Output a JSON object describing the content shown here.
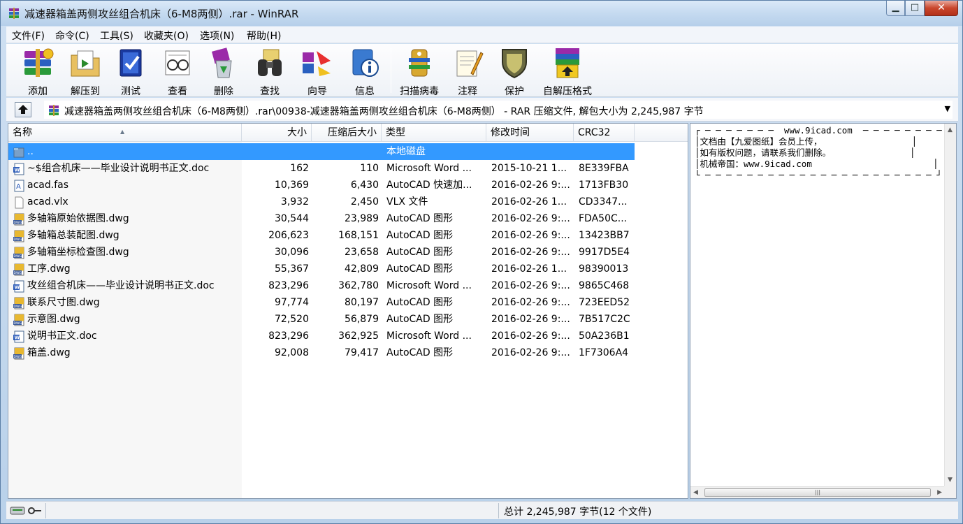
{
  "window": {
    "title": "减速器箱盖两侧攻丝组合机床（6-M8两侧）.rar - WinRAR",
    "minimize_glyph": "▁",
    "maximize_glyph": "□",
    "close_glyph": "✕"
  },
  "menu": {
    "items": [
      "文件(F)",
      "命令(C)",
      "工具(S)",
      "收藏夹(O)",
      "选项(N)",
      "帮助(H)"
    ]
  },
  "toolbar": {
    "buttons": [
      {
        "label": "添加",
        "icon": "books-stack-icon"
      },
      {
        "label": "解压到",
        "icon": "extract-folder-icon"
      },
      {
        "label": "测试",
        "icon": "test-book-icon"
      },
      {
        "label": "查看",
        "icon": "view-glasses-icon"
      },
      {
        "label": "删除",
        "icon": "delete-recycle-icon"
      },
      {
        "label": "查找",
        "icon": "binoculars-icon"
      },
      {
        "label": "向导",
        "icon": "wizard-icon"
      },
      {
        "label": "信息",
        "icon": "info-icon"
      },
      {
        "label": "扫描病毒",
        "icon": "virus-scan-icon"
      },
      {
        "label": "注释",
        "icon": "comment-note-icon"
      },
      {
        "label": "保护",
        "icon": "shield-protect-icon"
      },
      {
        "label": "自解压格式",
        "icon": "sfx-box-icon"
      }
    ]
  },
  "address": {
    "path": "减速器箱盖两侧攻丝组合机床（6-M8两侧）.rar\\00938-减速器箱盖两侧攻丝组合机床（6-M8两侧） - RAR 压缩文件, 解包大小为 2,245,987 字节",
    "dropdown_glyph": "▼"
  },
  "columns": {
    "name": "名称",
    "size": "大小",
    "packed": "压缩后大小",
    "type": "类型",
    "mtime": "修改时间",
    "crc": "CRC32"
  },
  "files": [
    {
      "name": "..",
      "size": "",
      "packed": "",
      "type": "本地磁盘",
      "mtime": "",
      "crc": "",
      "icon": "folder-up-icon",
      "selected": true
    },
    {
      "name": "~$组合机床——毕业设计说明书正文.doc",
      "size": "162",
      "packed": "110",
      "type": "Microsoft Word ...",
      "mtime": "2015-10-21 1...",
      "crc": "8E339FBA",
      "icon": "word-doc-icon"
    },
    {
      "name": "acad.fas",
      "size": "10,369",
      "packed": "6,430",
      "type": "AutoCAD 快速加...",
      "mtime": "2016-02-26 9:...",
      "crc": "1713FB30",
      "icon": "fas-file-icon"
    },
    {
      "name": "acad.vlx",
      "size": "3,932",
      "packed": "2,450",
      "type": "VLX 文件",
      "mtime": "2016-02-26 1...",
      "crc": "CD3347...",
      "icon": "blank-file-icon"
    },
    {
      "name": "多轴箱原始依据图.dwg",
      "size": "30,544",
      "packed": "23,989",
      "type": "AutoCAD 图形",
      "mtime": "2016-02-26 9:...",
      "crc": "FDA50C...",
      "icon": "dwg-file-icon"
    },
    {
      "name": "多轴箱总装配图.dwg",
      "size": "206,623",
      "packed": "168,151",
      "type": "AutoCAD 图形",
      "mtime": "2016-02-26 9:...",
      "crc": "13423BB7",
      "icon": "dwg-file-icon"
    },
    {
      "name": "多轴箱坐标检查图.dwg",
      "size": "30,096",
      "packed": "23,658",
      "type": "AutoCAD 图形",
      "mtime": "2016-02-26 9:...",
      "crc": "9917D5E4",
      "icon": "dwg-file-icon"
    },
    {
      "name": "工序.dwg",
      "size": "55,367",
      "packed": "42,809",
      "type": "AutoCAD 图形",
      "mtime": "2016-02-26 1...",
      "crc": "98390013",
      "icon": "dwg-file-icon"
    },
    {
      "name": "攻丝组合机床——毕业设计说明书正文.doc",
      "size": "823,296",
      "packed": "362,780",
      "type": "Microsoft Word ...",
      "mtime": "2016-02-26 9:...",
      "crc": "9865C468",
      "icon": "word-doc-icon"
    },
    {
      "name": "联系尺寸图.dwg",
      "size": "97,774",
      "packed": "80,197",
      "type": "AutoCAD 图形",
      "mtime": "2016-02-26 9:...",
      "crc": "723EED52",
      "icon": "dwg-file-icon"
    },
    {
      "name": "示意图.dwg",
      "size": "72,520",
      "packed": "56,879",
      "type": "AutoCAD 图形",
      "mtime": "2016-02-26 9:...",
      "crc": "7B517C2C",
      "icon": "dwg-file-icon"
    },
    {
      "name": "说明书正文.doc",
      "size": "823,296",
      "packed": "362,925",
      "type": "Microsoft Word ...",
      "mtime": "2016-02-26 9:...",
      "crc": "50A236B1",
      "icon": "word-doc-icon"
    },
    {
      "name": "箱盖.dwg",
      "size": "92,008",
      "packed": "79,417",
      "type": "AutoCAD 图形",
      "mtime": "2016-02-26 9:...",
      "crc": "1F7306A4",
      "icon": "dwg-file-icon"
    }
  ],
  "comment": {
    "text": "┌ ─ ─ ─ ─ ─ ─ ─  www.9icad.com  ─ ─ ─ ─ ─ ─ ─ ─ ┐\n│文档由【九爱图纸】会员上传，                 │\n│如有版权问题，请联系我们删除。               │\n│机械帝国：www.9icad.com                       │\n└ ─ ─ ─ ─ ─ ─ ─ ─ ─ ─ ─ ─ ─ ─ ─ ─ ─ ─ ─ ─ ─ ─ ┘"
  },
  "status": {
    "total": "总计 2,245,987 字节(12 个文件)"
  }
}
